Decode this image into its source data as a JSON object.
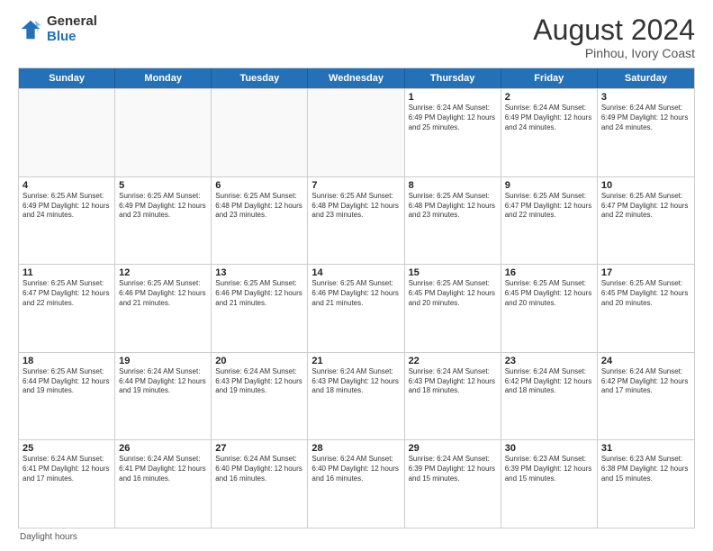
{
  "header": {
    "logo": {
      "general": "General",
      "blue": "Blue"
    },
    "title": "August 2024",
    "subtitle": "Pinhou, Ivory Coast"
  },
  "calendar": {
    "days_of_week": [
      "Sunday",
      "Monday",
      "Tuesday",
      "Wednesday",
      "Thursday",
      "Friday",
      "Saturday"
    ],
    "footer": "Daylight hours",
    "weeks": [
      [
        {
          "day": "",
          "info": "",
          "empty": true
        },
        {
          "day": "",
          "info": "",
          "empty": true
        },
        {
          "day": "",
          "info": "",
          "empty": true
        },
        {
          "day": "",
          "info": "",
          "empty": true
        },
        {
          "day": "1",
          "info": "Sunrise: 6:24 AM\nSunset: 6:49 PM\nDaylight: 12 hours\nand 25 minutes.",
          "empty": false
        },
        {
          "day": "2",
          "info": "Sunrise: 6:24 AM\nSunset: 6:49 PM\nDaylight: 12 hours\nand 24 minutes.",
          "empty": false
        },
        {
          "day": "3",
          "info": "Sunrise: 6:24 AM\nSunset: 6:49 PM\nDaylight: 12 hours\nand 24 minutes.",
          "empty": false
        }
      ],
      [
        {
          "day": "4",
          "info": "Sunrise: 6:25 AM\nSunset: 6:49 PM\nDaylight: 12 hours\nand 24 minutes.",
          "empty": false
        },
        {
          "day": "5",
          "info": "Sunrise: 6:25 AM\nSunset: 6:49 PM\nDaylight: 12 hours\nand 23 minutes.",
          "empty": false
        },
        {
          "day": "6",
          "info": "Sunrise: 6:25 AM\nSunset: 6:48 PM\nDaylight: 12 hours\nand 23 minutes.",
          "empty": false
        },
        {
          "day": "7",
          "info": "Sunrise: 6:25 AM\nSunset: 6:48 PM\nDaylight: 12 hours\nand 23 minutes.",
          "empty": false
        },
        {
          "day": "8",
          "info": "Sunrise: 6:25 AM\nSunset: 6:48 PM\nDaylight: 12 hours\nand 23 minutes.",
          "empty": false
        },
        {
          "day": "9",
          "info": "Sunrise: 6:25 AM\nSunset: 6:47 PM\nDaylight: 12 hours\nand 22 minutes.",
          "empty": false
        },
        {
          "day": "10",
          "info": "Sunrise: 6:25 AM\nSunset: 6:47 PM\nDaylight: 12 hours\nand 22 minutes.",
          "empty": false
        }
      ],
      [
        {
          "day": "11",
          "info": "Sunrise: 6:25 AM\nSunset: 6:47 PM\nDaylight: 12 hours\nand 22 minutes.",
          "empty": false
        },
        {
          "day": "12",
          "info": "Sunrise: 6:25 AM\nSunset: 6:46 PM\nDaylight: 12 hours\nand 21 minutes.",
          "empty": false
        },
        {
          "day": "13",
          "info": "Sunrise: 6:25 AM\nSunset: 6:46 PM\nDaylight: 12 hours\nand 21 minutes.",
          "empty": false
        },
        {
          "day": "14",
          "info": "Sunrise: 6:25 AM\nSunset: 6:46 PM\nDaylight: 12 hours\nand 21 minutes.",
          "empty": false
        },
        {
          "day": "15",
          "info": "Sunrise: 6:25 AM\nSunset: 6:45 PM\nDaylight: 12 hours\nand 20 minutes.",
          "empty": false
        },
        {
          "day": "16",
          "info": "Sunrise: 6:25 AM\nSunset: 6:45 PM\nDaylight: 12 hours\nand 20 minutes.",
          "empty": false
        },
        {
          "day": "17",
          "info": "Sunrise: 6:25 AM\nSunset: 6:45 PM\nDaylight: 12 hours\nand 20 minutes.",
          "empty": false
        }
      ],
      [
        {
          "day": "18",
          "info": "Sunrise: 6:25 AM\nSunset: 6:44 PM\nDaylight: 12 hours\nand 19 minutes.",
          "empty": false
        },
        {
          "day": "19",
          "info": "Sunrise: 6:24 AM\nSunset: 6:44 PM\nDaylight: 12 hours\nand 19 minutes.",
          "empty": false
        },
        {
          "day": "20",
          "info": "Sunrise: 6:24 AM\nSunset: 6:43 PM\nDaylight: 12 hours\nand 19 minutes.",
          "empty": false
        },
        {
          "day": "21",
          "info": "Sunrise: 6:24 AM\nSunset: 6:43 PM\nDaylight: 12 hours\nand 18 minutes.",
          "empty": false
        },
        {
          "day": "22",
          "info": "Sunrise: 6:24 AM\nSunset: 6:43 PM\nDaylight: 12 hours\nand 18 minutes.",
          "empty": false
        },
        {
          "day": "23",
          "info": "Sunrise: 6:24 AM\nSunset: 6:42 PM\nDaylight: 12 hours\nand 18 minutes.",
          "empty": false
        },
        {
          "day": "24",
          "info": "Sunrise: 6:24 AM\nSunset: 6:42 PM\nDaylight: 12 hours\nand 17 minutes.",
          "empty": false
        }
      ],
      [
        {
          "day": "25",
          "info": "Sunrise: 6:24 AM\nSunset: 6:41 PM\nDaylight: 12 hours\nand 17 minutes.",
          "empty": false
        },
        {
          "day": "26",
          "info": "Sunrise: 6:24 AM\nSunset: 6:41 PM\nDaylight: 12 hours\nand 16 minutes.",
          "empty": false
        },
        {
          "day": "27",
          "info": "Sunrise: 6:24 AM\nSunset: 6:40 PM\nDaylight: 12 hours\nand 16 minutes.",
          "empty": false
        },
        {
          "day": "28",
          "info": "Sunrise: 6:24 AM\nSunset: 6:40 PM\nDaylight: 12 hours\nand 16 minutes.",
          "empty": false
        },
        {
          "day": "29",
          "info": "Sunrise: 6:24 AM\nSunset: 6:39 PM\nDaylight: 12 hours\nand 15 minutes.",
          "empty": false
        },
        {
          "day": "30",
          "info": "Sunrise: 6:23 AM\nSunset: 6:39 PM\nDaylight: 12 hours\nand 15 minutes.",
          "empty": false
        },
        {
          "day": "31",
          "info": "Sunrise: 6:23 AM\nSunset: 6:38 PM\nDaylight: 12 hours\nand 15 minutes.",
          "empty": false
        }
      ]
    ]
  }
}
